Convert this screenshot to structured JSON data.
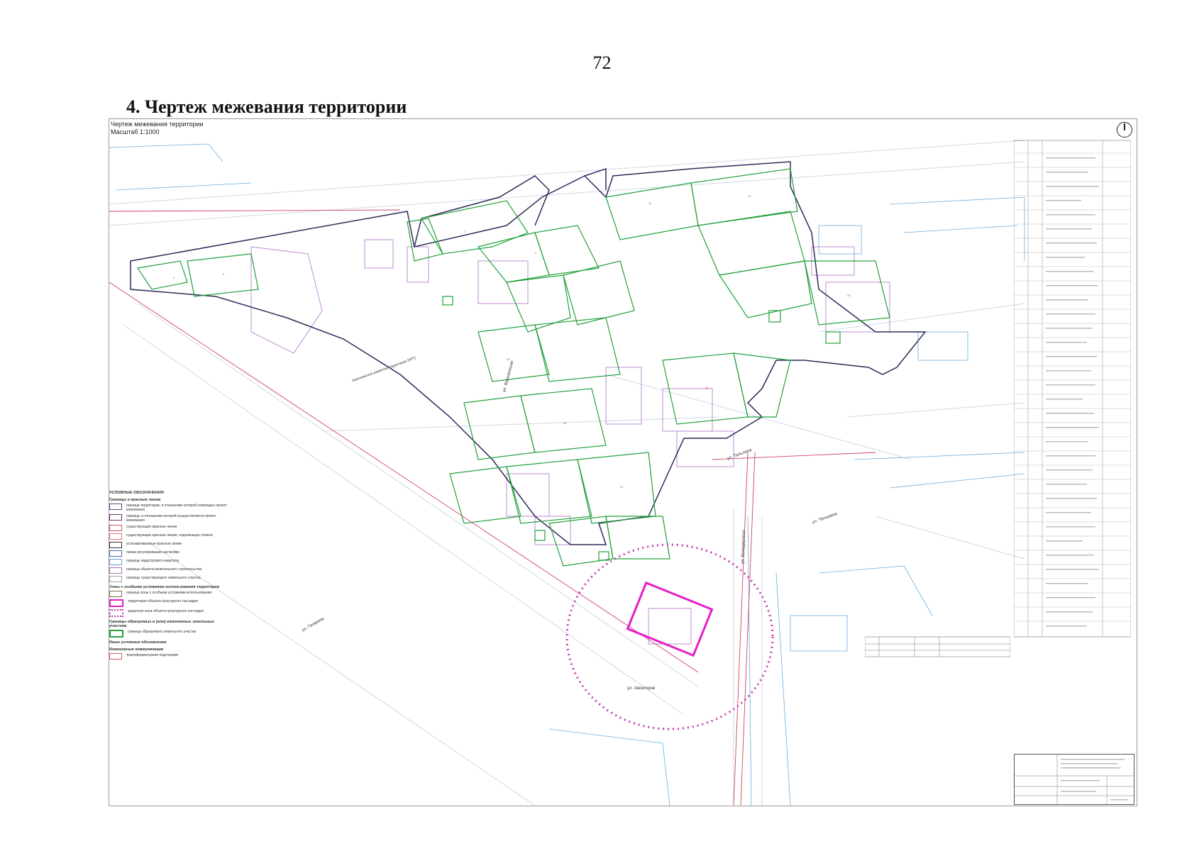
{
  "page": {
    "number": "72",
    "heading": "4.  Чертеж межевания территории"
  },
  "sheet": {
    "title": "Чертеж межевания территории",
    "scale": "Масштаб 1:1000"
  },
  "streets": [
    {
      "name": "ул. Гагарина"
    },
    {
      "name": "ул. Тельмана"
    },
    {
      "name": "ул. Авиаторов"
    },
    {
      "name": "ул. Володарского"
    },
    {
      "name": "ул. Фрунзенская"
    },
    {
      "name": "ул. Тальлина"
    }
  ],
  "zone_label": "Комплексное развитие территории (КРТ)",
  "legend": {
    "title": "УСЛОВНЫЕ ОБОЗНАЧЕНИЯ",
    "group1": "Границы и красные линии",
    "group2": "Зоны с особыми условиями использования территории",
    "group3": "Границы образуемых и (или) изменяемых земельных участков",
    "group4": "Иные условные обозначения",
    "group5": "Инженерные коммуникации",
    "items": [
      {
        "label": "граница территории, в отношении которой утвержден проект межевания",
        "color": "#5a4b8c"
      },
      {
        "label": "граница, в отношении которой осуществляется проект межевания",
        "color": "#7a2f7a"
      },
      {
        "label": "существующие красные линии",
        "color": "#d04a6a"
      },
      {
        "label": "существующие красные линии, подлежащие отмене",
        "color": "#e07a7a"
      },
      {
        "label": "устанавливаемые красные линии",
        "color": "#333333"
      },
      {
        "label": "линии регулирования застройки",
        "color": "#4a6aa8"
      },
      {
        "label": "границы кадастрового квартала",
        "color": "#6aa0d0"
      },
      {
        "label": "граница объекта капитального строительства",
        "color": "#b070b0"
      },
      {
        "label": "границы существующего земельного участка",
        "color": "#a0a0a0"
      },
      {
        "label": "граница зоны с особыми условиями использования",
        "color": "#8a6a4a"
      },
      {
        "label": "территория объекта культурного наследия",
        "color": "#e020c0"
      },
      {
        "label": "защитная зона объекта культурного наследия",
        "color": "#c030b0"
      },
      {
        "label": "граница образуемого земельного участка",
        "color": "#2aa040"
      },
      {
        "label": "трансформаторная подстанция",
        "color": "#d06060"
      }
    ]
  },
  "map": {
    "colors": {
      "boundary": "#2e2a5a",
      "parcel": "#21a03a",
      "red_line": "#d0406a",
      "cadastral": "#6aaee0",
      "building": "#b97fcf",
      "heritage": "#e51ec5",
      "street": "#cfd7e6"
    }
  }
}
